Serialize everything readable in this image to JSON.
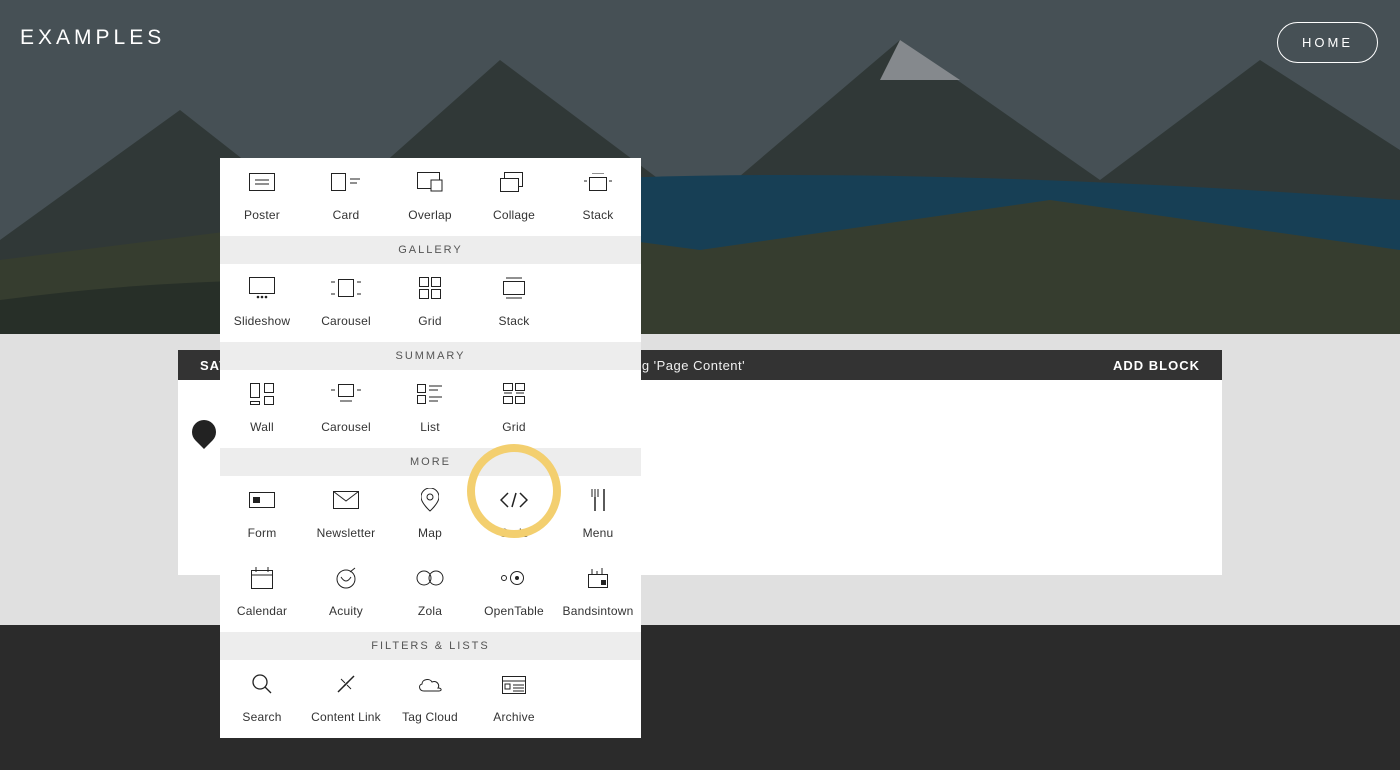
{
  "hero": {
    "title": "EXAMPLES",
    "home_label": "HOME"
  },
  "editor_bar": {
    "save_label": "SAVE",
    "center_label": "Editing 'Page Content'",
    "add_label": "ADD BLOCK"
  },
  "picker": {
    "sections": {
      "image_row": {
        "items": [
          {
            "label": "Poster"
          },
          {
            "label": "Card"
          },
          {
            "label": "Overlap"
          },
          {
            "label": "Collage"
          },
          {
            "label": "Stack"
          }
        ]
      },
      "gallery": {
        "title": "GALLERY",
        "items": [
          {
            "label": "Slideshow"
          },
          {
            "label": "Carousel"
          },
          {
            "label": "Grid"
          },
          {
            "label": "Stack"
          }
        ]
      },
      "summary": {
        "title": "SUMMARY",
        "items": [
          {
            "label": "Wall"
          },
          {
            "label": "Carousel"
          },
          {
            "label": "List"
          },
          {
            "label": "Grid"
          }
        ]
      },
      "more": {
        "title": "MORE",
        "row1": [
          {
            "label": "Form"
          },
          {
            "label": "Newsletter"
          },
          {
            "label": "Map"
          },
          {
            "label": "Code"
          },
          {
            "label": "Menu"
          }
        ],
        "row2": [
          {
            "label": "Calendar"
          },
          {
            "label": "Acuity"
          },
          {
            "label": "Zola"
          },
          {
            "label": "OpenTable"
          },
          {
            "label": "Bandsintown"
          }
        ]
      },
      "filters": {
        "title": "FILTERS & LISTS",
        "items": [
          {
            "label": "Search"
          },
          {
            "label": "Content Link"
          },
          {
            "label": "Tag Cloud"
          },
          {
            "label": "Archive"
          }
        ]
      }
    }
  }
}
